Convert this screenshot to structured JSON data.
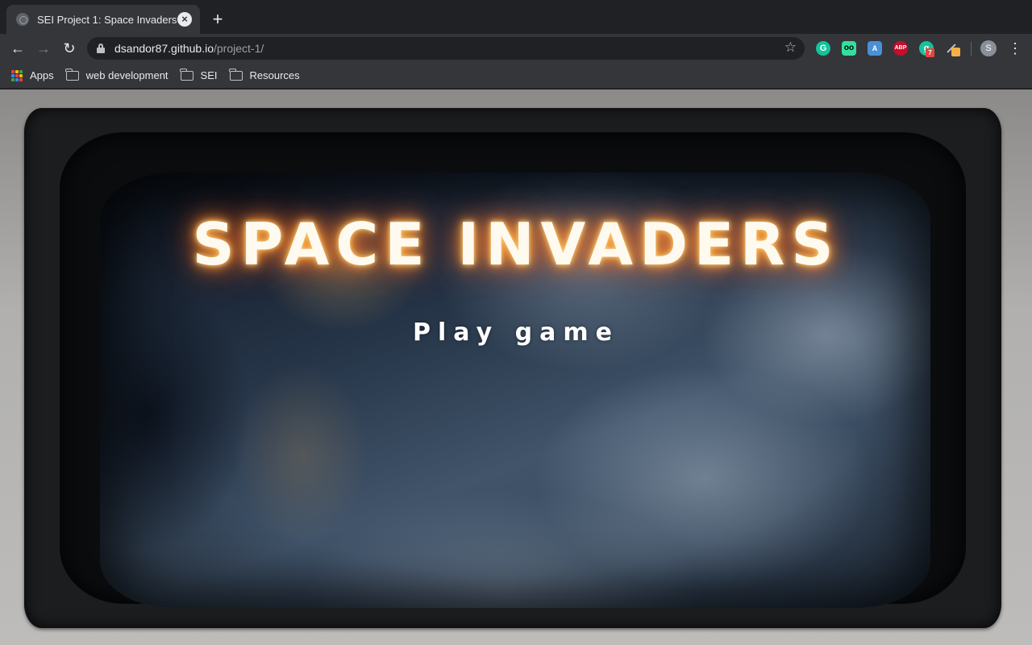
{
  "tab": {
    "title": "SEI Project 1: Space Invaders",
    "close": "×",
    "new_tab": "+"
  },
  "toolbar": {
    "back": "←",
    "forward": "→",
    "reload": "↻",
    "url_host": "dsandor87.github.io",
    "url_path": "/project-1/",
    "star": "☆",
    "extensions": [
      {
        "name": "grammarly",
        "glyph": "G"
      },
      {
        "name": "tripadvisor",
        "glyph": "oo"
      },
      {
        "name": "translate",
        "glyph": "A"
      },
      {
        "name": "adblock-plus",
        "glyph": "ABP"
      },
      {
        "name": "grammarly-g2",
        "glyph": "g",
        "badge": "7"
      },
      {
        "name": "pen-highlighter",
        "glyph": ""
      }
    ],
    "avatar_letter": "S",
    "menu": "⋮"
  },
  "bookmarks": [
    {
      "label": "Apps",
      "icon": "apps-grid-icon"
    },
    {
      "label": "web development",
      "icon": "folder-icon"
    },
    {
      "label": "SEI",
      "icon": "folder-icon"
    },
    {
      "label": "Resources",
      "icon": "folder-icon"
    }
  ],
  "apps_colors": [
    "#ea4335",
    "#fbbc05",
    "#34a853",
    "#4285f4",
    "#ea4335",
    "#fbbc05",
    "#34a853",
    "#4285f4",
    "#ea4335"
  ],
  "page": {
    "title": "SPACE INVADERS",
    "play_button": "Play game"
  }
}
